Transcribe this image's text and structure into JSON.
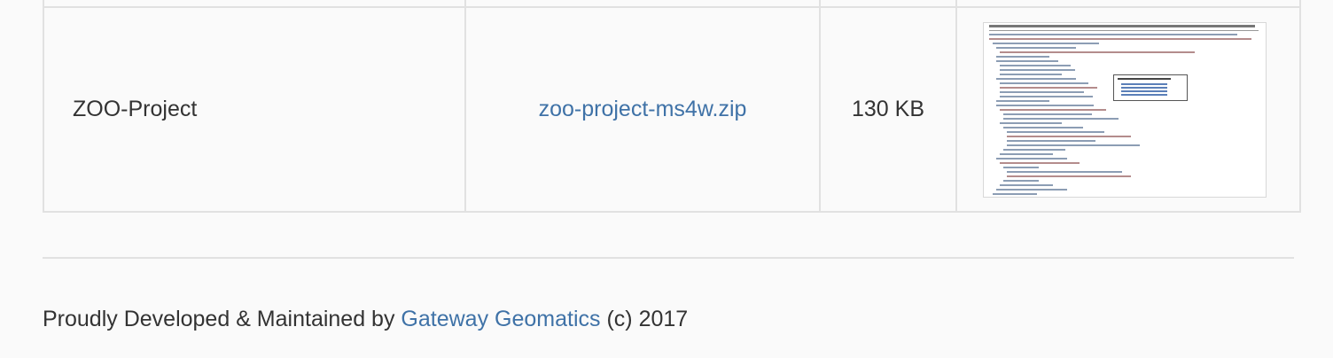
{
  "table": {
    "row": {
      "project_name": "ZOO-Project",
      "download_link": "zoo-project-ms4w.zip",
      "file_size": "130 KB",
      "screenshot_alt": "This XML file does not appear to have any style information associated with it. The document tree is shown below."
    }
  },
  "footer": {
    "prefix": "Proudly Developed & Maintained by",
    "company_link": "Gateway Geomatics",
    "suffix": "(c) 2017"
  },
  "colors": {
    "link": "#3f72a7",
    "text": "#333333",
    "border": "#e1e1e1",
    "background": "#fafafa"
  }
}
